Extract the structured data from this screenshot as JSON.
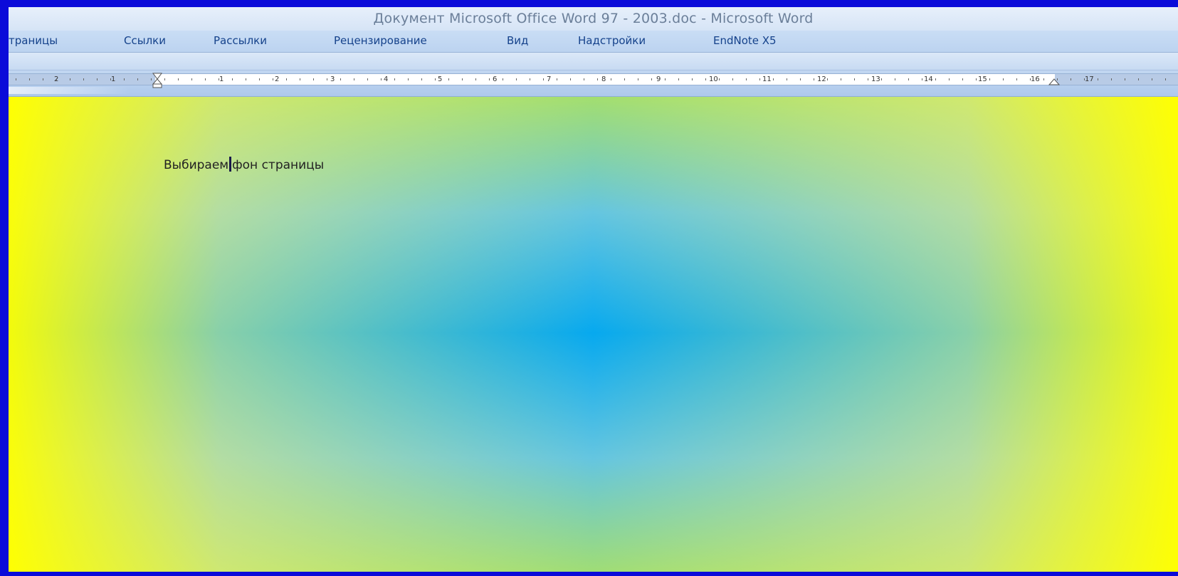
{
  "window": {
    "title": "Документ Microsoft Office Word 97 - 2003.doc - Microsoft Word"
  },
  "ribbon_tabs": [
    {
      "label": "траницы"
    },
    {
      "label": "Ссылки"
    },
    {
      "label": "Рассылки"
    },
    {
      "label": "Рецензирование"
    },
    {
      "label": "Вид"
    },
    {
      "label": "Надстройки"
    },
    {
      "label": "EndNote X5"
    }
  ],
  "ruler": {
    "labels": [
      "2",
      "1",
      "1",
      "2",
      "3",
      "4",
      "5",
      "6",
      "7",
      "8",
      "9",
      "10",
      "11",
      "12",
      "13",
      "14",
      "15",
      "16",
      "17"
    ]
  },
  "document": {
    "text_before_cursor": "Выбираем",
    "text_after_cursor": "фон страницы",
    "background_colors": [
      "#ffff00",
      "#00aaee"
    ]
  },
  "icons": {
    "left_indent_marker": "hourglass-indent-icon",
    "right_indent_marker": "triangle-indent-icon"
  }
}
